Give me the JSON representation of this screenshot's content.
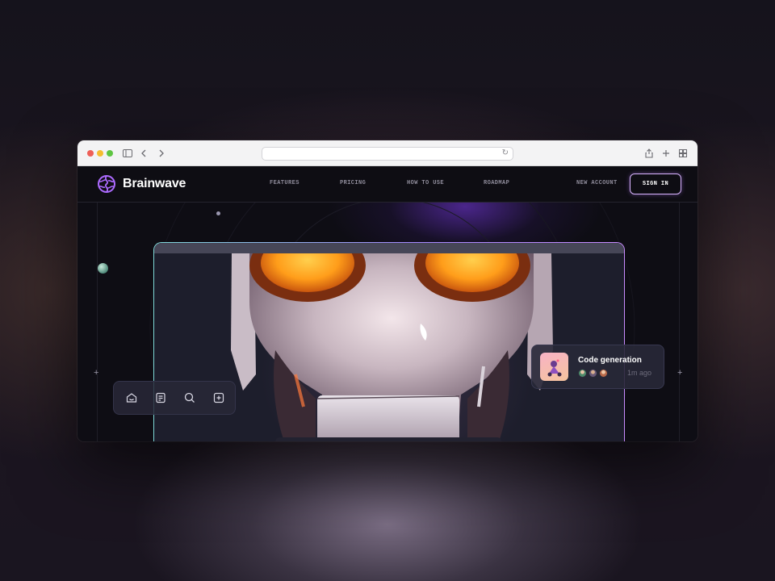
{
  "browser": {
    "url": "",
    "icons": [
      "sidebar-icon",
      "back-icon",
      "forward-icon",
      "reload-icon",
      "share-icon",
      "new-tab-icon",
      "tab-overview-icon"
    ]
  },
  "site": {
    "brand": "Brainwave",
    "nav": [
      "FEATURES",
      "PRICING",
      "HOW TO USE",
      "ROADMAP"
    ],
    "new_account": "NEW ACCOUNT",
    "sign_in": "SIGN IN",
    "accent_color": "#ac6aff",
    "eye_color": "#ff9d1a"
  },
  "toolbar": {
    "icons": [
      "home-icon",
      "file-icon",
      "search-icon",
      "plus-icon"
    ]
  },
  "notification": {
    "title": "Code generation",
    "time": "1m ago"
  }
}
